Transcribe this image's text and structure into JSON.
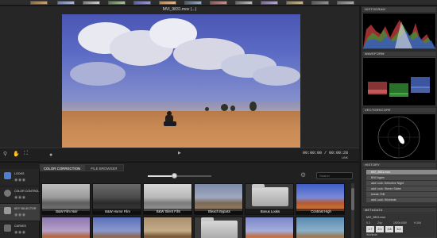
{
  "viewer": {
    "title": "MVI_9831.mov (...)",
    "timecode": "00:00:00 / 00:00:28",
    "zoom_label": "LINK"
  },
  "panels": {
    "histogram": "HISTOGRAM",
    "waveform": "WAVEFORM",
    "vectorscope": "VECTORSCOPE",
    "history": "HISTORY",
    "metadata": "METADATA"
  },
  "history": {
    "items": [
      {
        "label": "MVI_9831.mov",
        "selected": true
      },
      {
        "label": "B/W Again",
        "selected": false
      },
      {
        "label": "add Look: Detective Night",
        "selected": false
      },
      {
        "label": "add Look: Stereo Stabe",
        "selected": false
      },
      {
        "label": "tweak: ISB",
        "selected": false
      },
      {
        "label": "add Look: Wichinde",
        "selected": false
      }
    ]
  },
  "metadata": {
    "filename": "MVI_9831.mov",
    "row1": [
      "5.3",
      "24p",
      "1920x1080",
      "H.264"
    ],
    "row2": [
      "1.7",
      "2.1",
      "3.8",
      "5.4"
    ],
    "tail": "Wichinde"
  },
  "library": {
    "tabs": [
      {
        "label": "COLOR CORRECTION",
        "active": true
      },
      {
        "label": "FILE BROWSER",
        "active": false
      }
    ],
    "search_placeholder": "Search",
    "slider_value": 0.42,
    "sidebar": [
      {
        "label": "LOOKS",
        "active": false,
        "color": "#4d7fd4"
      },
      {
        "label": "COLOR CONTROL",
        "active": false,
        "color": "#777777"
      },
      {
        "label": "KEY SELECTOR",
        "active": true,
        "color": "#999999"
      },
      {
        "label": "CURVES",
        "active": false,
        "color": "#6b6b6b"
      }
    ],
    "thumbnails": [
      {
        "label": "B&W Film Noir",
        "style": "bw"
      },
      {
        "label": "B&W Horror Film",
        "style": "bwdark"
      },
      {
        "label": "B&W Silent Film",
        "style": "bwlight"
      },
      {
        "label": "Bleach Bypass",
        "style": "bleach"
      },
      {
        "label": "Bonus Looks",
        "style": "folder"
      },
      {
        "label": "Contrast High",
        "style": "contrast"
      },
      {
        "label": "",
        "style": "warm"
      },
      {
        "label": "",
        "style": "cool"
      },
      {
        "label": "",
        "style": "sepia"
      },
      {
        "label": "",
        "style": "folder"
      },
      {
        "label": "",
        "style": "warm2"
      },
      {
        "label": "",
        "style": "teal"
      }
    ]
  },
  "colors": {
    "accent": "#4d7fd4",
    "panel_bg": "#2a2a2a",
    "viewer_bg": "#262626"
  }
}
